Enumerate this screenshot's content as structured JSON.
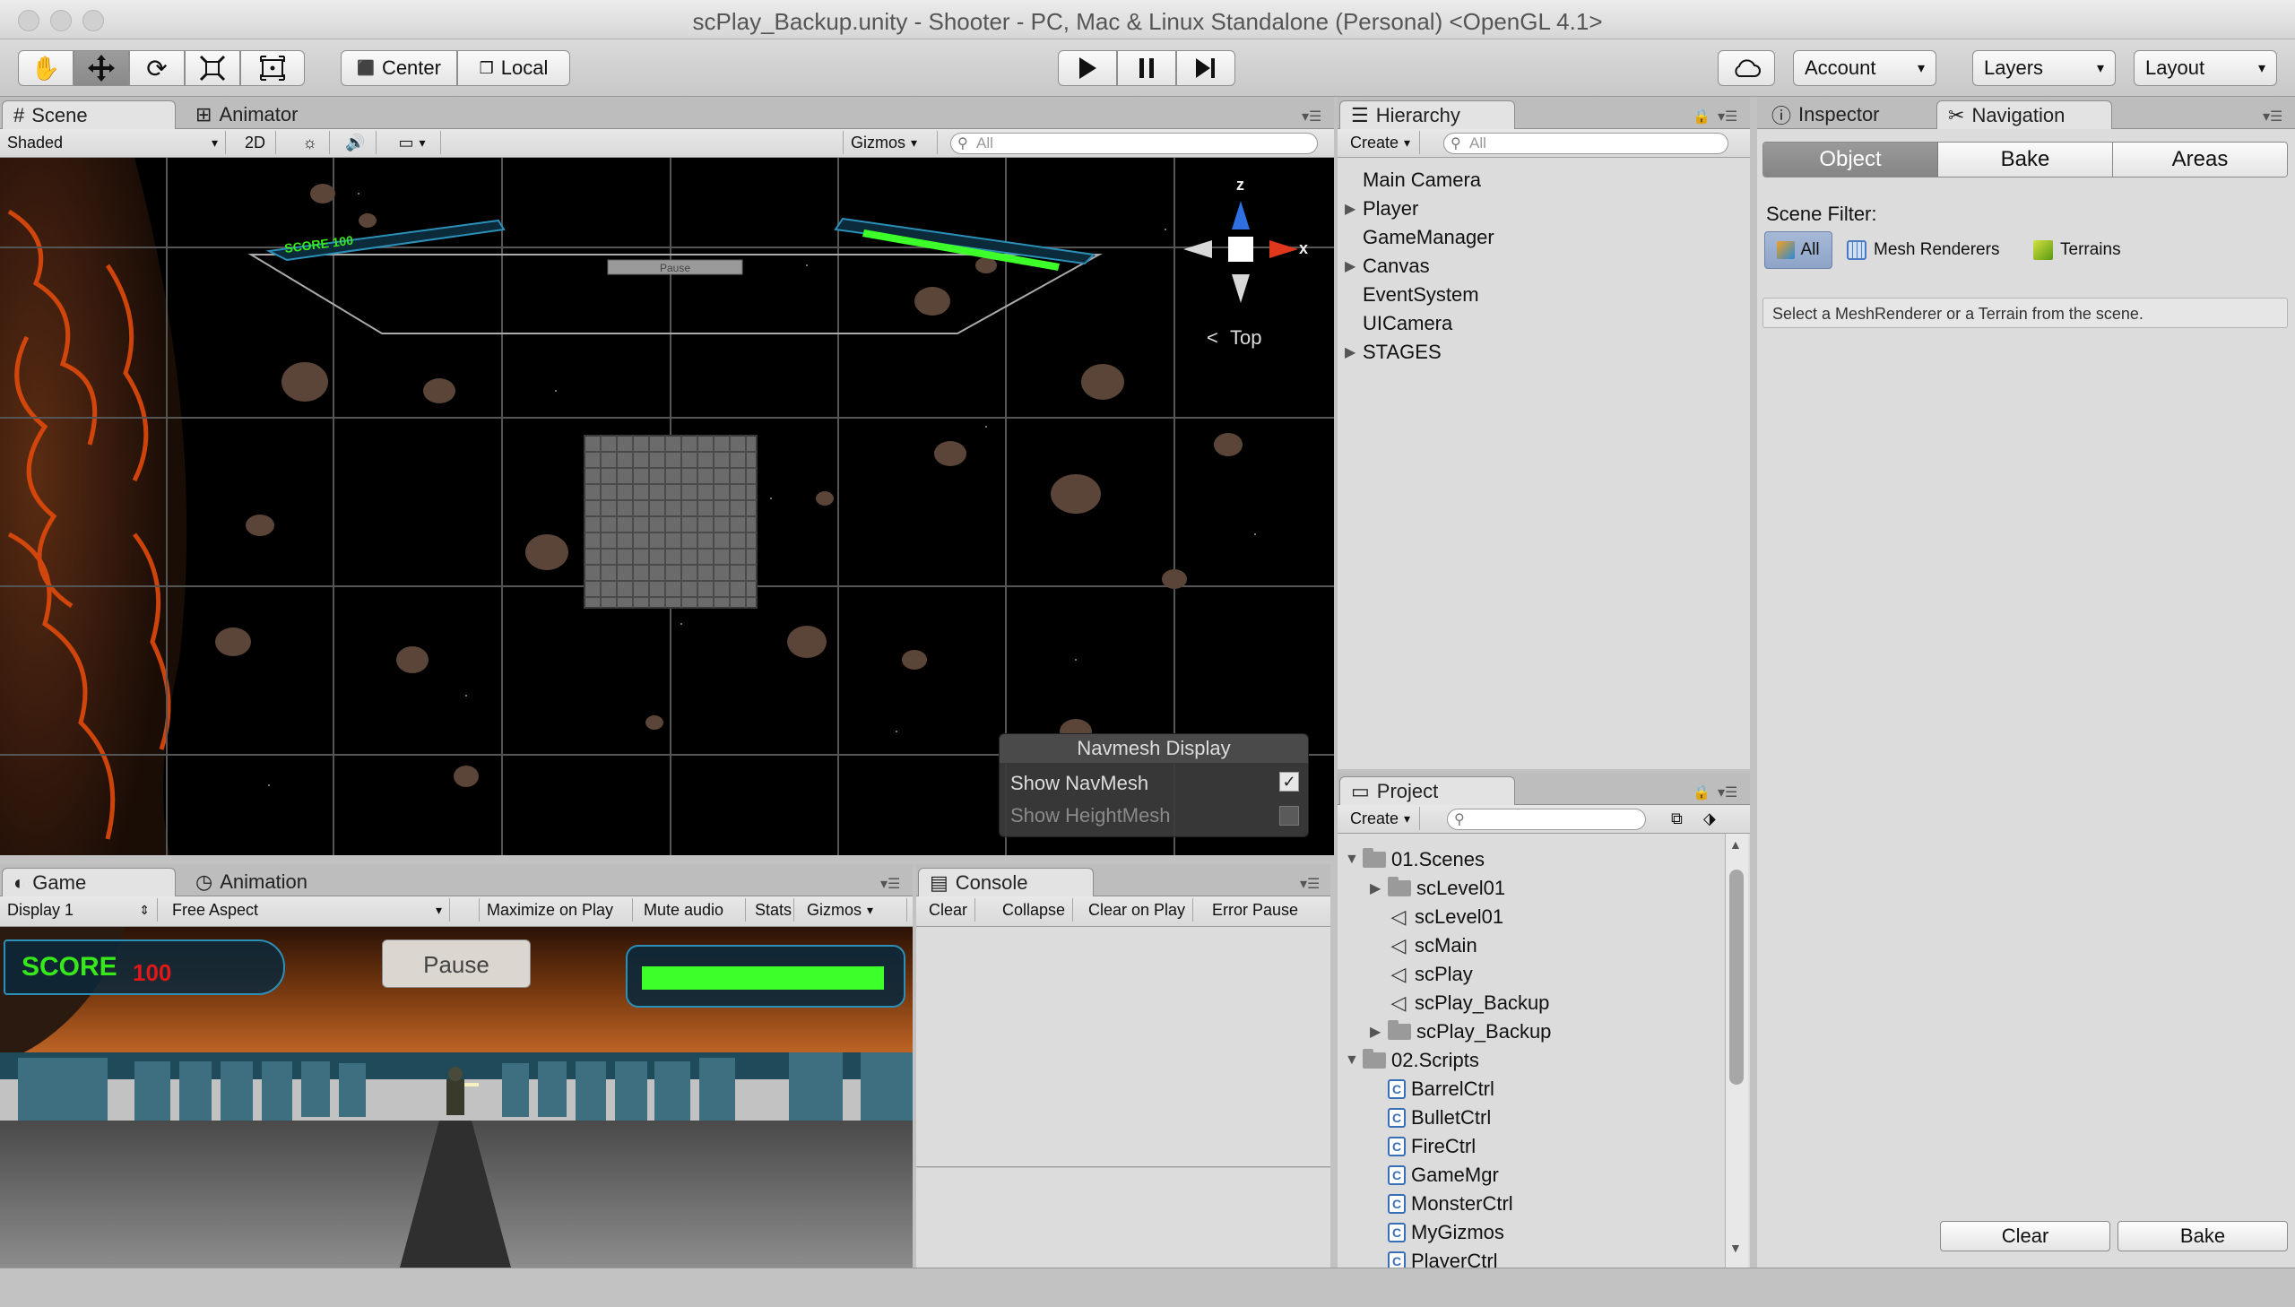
{
  "window": {
    "title": "scPlay_Backup.unity - Shooter - PC, Mac & Linux Standalone (Personal) <OpenGL 4.1>"
  },
  "toolbar": {
    "pivot_label": "Center",
    "space_label": "Local",
    "account_label": "Account",
    "layers_label": "Layers",
    "layout_label": "Layout"
  },
  "scene_panel": {
    "tabs": [
      "Scene",
      "Animator"
    ],
    "shading_mode": "Shaded",
    "mode_2d": "2D",
    "gizmos_label": "Gizmos",
    "search_placeholder": "All",
    "gizmo_view_label": "Top",
    "axis_z": "z",
    "axis_x": "x",
    "overlay_score": "SCORE 100",
    "overlay_pause": "Pause",
    "navmesh": {
      "title": "Navmesh Display",
      "show_navmesh_label": "Show NavMesh",
      "show_navmesh_checked": true,
      "show_heightmesh_label": "Show HeightMesh",
      "show_heightmesh_checked": false
    }
  },
  "game_panel": {
    "tabs": [
      "Game",
      "Animation"
    ],
    "display_label": "Display 1",
    "aspect_label": "Free Aspect",
    "maximize_label": "Maximize on Play",
    "mute_label": "Mute audio",
    "stats_label": "Stats",
    "gizmos_label": "Gizmos",
    "score_label": "SCORE",
    "score_value": "100",
    "pause_label": "Pause",
    "health_fraction": 0.97
  },
  "console_panel": {
    "tab": "Console",
    "clear_label": "Clear",
    "collapse_label": "Collapse",
    "clear_on_play_label": "Clear on Play",
    "error_pause_label": "Error Pause"
  },
  "hierarchy": {
    "tab": "Hierarchy",
    "create_label": "Create",
    "search_placeholder": "All",
    "items": [
      {
        "label": "Main Camera",
        "expandable": false
      },
      {
        "label": "Player",
        "expandable": true
      },
      {
        "label": "GameManager",
        "expandable": false
      },
      {
        "label": "Canvas",
        "expandable": true
      },
      {
        "label": "EventSystem",
        "expandable": false
      },
      {
        "label": "UICamera",
        "expandable": false
      },
      {
        "label": "STAGES",
        "expandable": true
      }
    ]
  },
  "project": {
    "tab": "Project",
    "create_label": "Create",
    "items": [
      {
        "label": "01.Scenes",
        "type": "folder",
        "indent": 0,
        "arrow": "open"
      },
      {
        "label": "scLevel01",
        "type": "folder",
        "indent": 1,
        "arrow": "closed"
      },
      {
        "label": "scLevel01",
        "type": "scene",
        "indent": 1,
        "arrow": "none"
      },
      {
        "label": "scMain",
        "type": "scene",
        "indent": 1,
        "arrow": "none"
      },
      {
        "label": "scPlay",
        "type": "scene",
        "indent": 1,
        "arrow": "none"
      },
      {
        "label": "scPlay_Backup",
        "type": "scene",
        "indent": 1,
        "arrow": "none"
      },
      {
        "label": "scPlay_Backup",
        "type": "folder",
        "indent": 1,
        "arrow": "closed"
      },
      {
        "label": "02.Scripts",
        "type": "folder",
        "indent": 0,
        "arrow": "open"
      },
      {
        "label": "BarrelCtrl",
        "type": "script",
        "indent": 1,
        "arrow": "none"
      },
      {
        "label": "BulletCtrl",
        "type": "script",
        "indent": 1,
        "arrow": "none"
      },
      {
        "label": "FireCtrl",
        "type": "script",
        "indent": 1,
        "arrow": "none"
      },
      {
        "label": "GameMgr",
        "type": "script",
        "indent": 1,
        "arrow": "none"
      },
      {
        "label": "MonsterCtrl",
        "type": "script",
        "indent": 1,
        "arrow": "none"
      },
      {
        "label": "MyGizmos",
        "type": "script",
        "indent": 1,
        "arrow": "none"
      },
      {
        "label": "PlayerCtrl",
        "type": "script",
        "indent": 1,
        "arrow": "none"
      }
    ]
  },
  "navigation": {
    "tabs": [
      "Inspector",
      "Navigation"
    ],
    "segments": [
      "Object",
      "Bake",
      "Areas"
    ],
    "selected_segment": "Object",
    "scene_filter_label": "Scene Filter:",
    "filter_all": "All",
    "filter_mesh": "Mesh Renderers",
    "filter_terrains": "Terrains",
    "hint": "Select a MeshRenderer or a Terrain from the scene.",
    "clear_label": "Clear",
    "bake_label": "Bake"
  },
  "colors": {
    "health_green": "#3dff2a",
    "score_green": "#37e81a",
    "score_red": "#e01818",
    "lava": "#e04a0c"
  }
}
